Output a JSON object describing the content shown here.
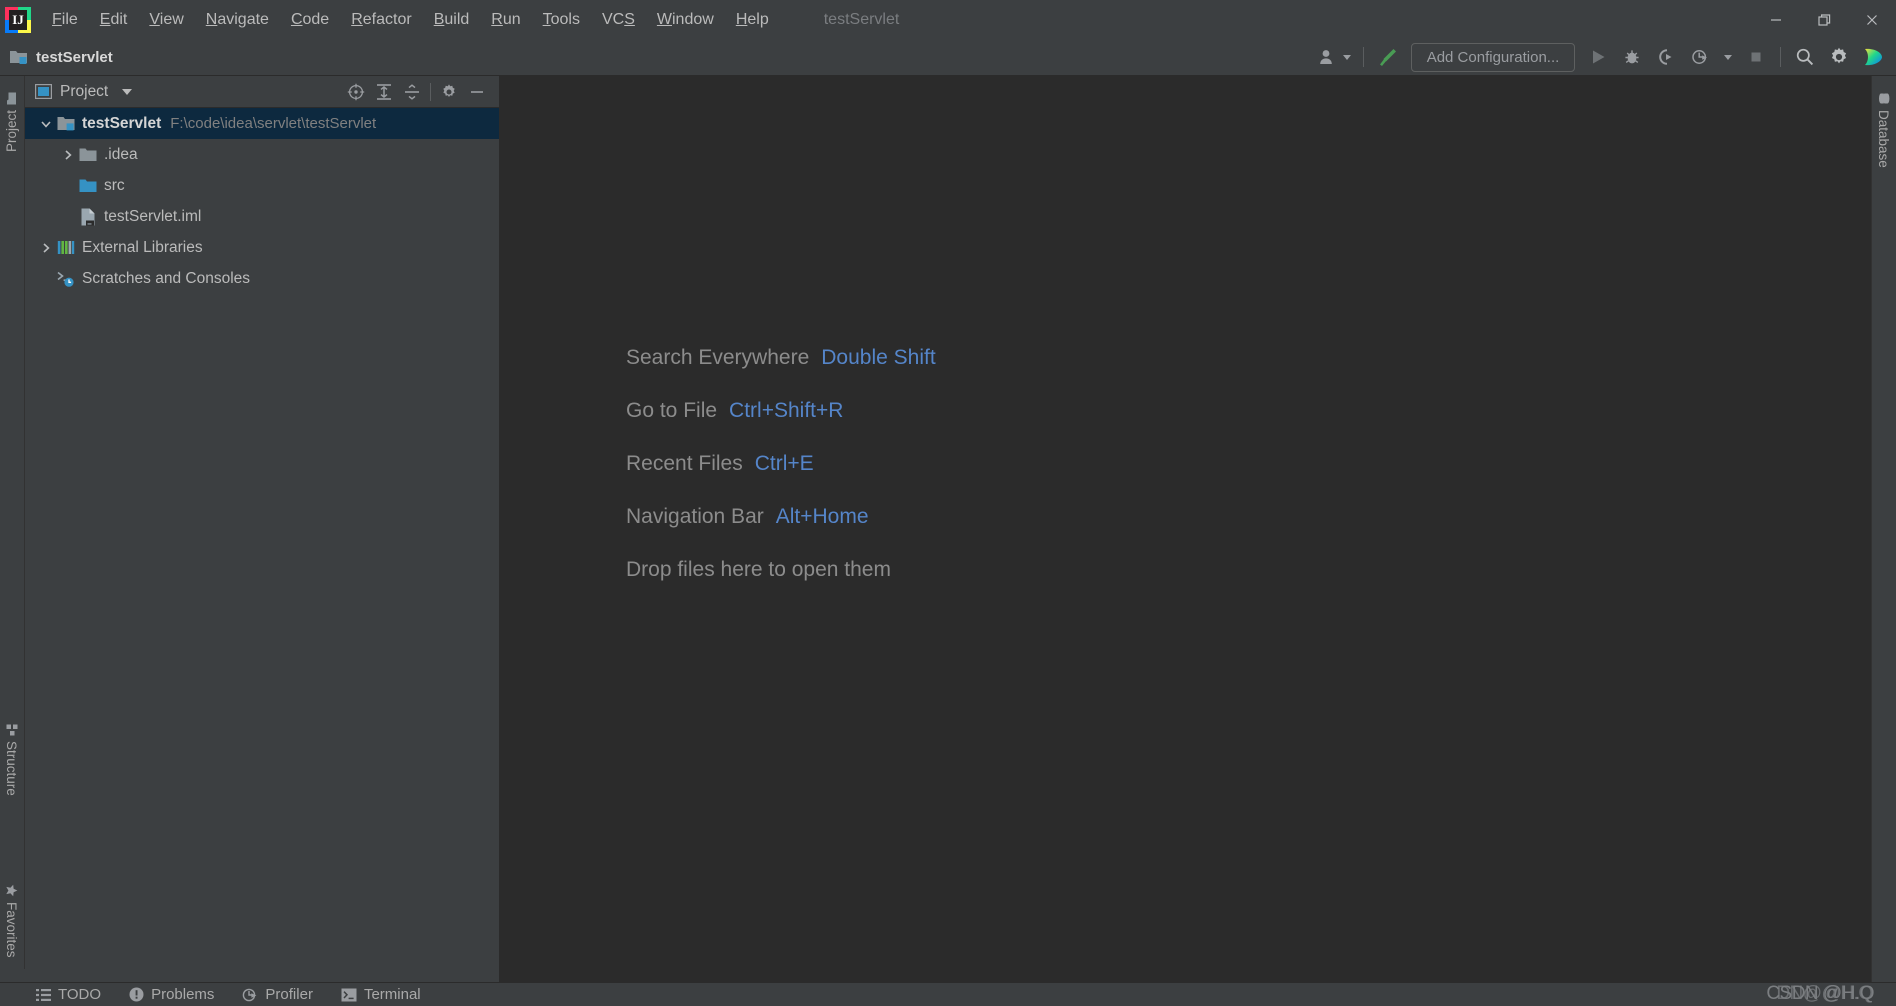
{
  "window": {
    "title": "testServlet",
    "controls": [
      {
        "name": "minimize-button",
        "glyph": "minimize"
      },
      {
        "name": "restore-button",
        "glyph": "restore"
      },
      {
        "name": "close-button",
        "glyph": "close"
      }
    ]
  },
  "menubar": {
    "logo_text": "IJ",
    "items": [
      {
        "label": "File",
        "mnemonic": "F",
        "rest": "ile"
      },
      {
        "label": "Edit",
        "mnemonic": "E",
        "rest": "dit"
      },
      {
        "label": "View",
        "mnemonic": "V",
        "rest": "iew"
      },
      {
        "label": "Navigate",
        "mnemonic": "N",
        "rest": "avigate"
      },
      {
        "label": "Code",
        "mnemonic": "C",
        "rest": "ode"
      },
      {
        "label": "Refactor",
        "mnemonic": "R",
        "rest": "efactor"
      },
      {
        "label": "Build",
        "mnemonic": "B",
        "rest": "uild"
      },
      {
        "label": "Run",
        "mnemonic": "R",
        "rest": "un",
        "split": true
      },
      {
        "label": "Tools",
        "mnemonic": "T",
        "rest": "ools"
      },
      {
        "label": "VCS",
        "mnemonic": "VC",
        "rest": "S",
        "tail": true
      },
      {
        "label": "Window",
        "mnemonic": "W",
        "rest": "indow"
      },
      {
        "label": "Help",
        "mnemonic": "H",
        "rest": "elp"
      }
    ]
  },
  "toolbar": {
    "project_chip_label": "testServlet",
    "add_configuration_label": "Add Configuration...",
    "buttons": [
      {
        "name": "user-account-button",
        "icon": "user-icon"
      },
      {
        "name": "build-hammer-button",
        "icon": "hammer-icon"
      },
      {
        "name": "run-button",
        "icon": "run-icon"
      },
      {
        "name": "debug-button",
        "icon": "debug-icon"
      },
      {
        "name": "run-coverage-button",
        "icon": "coverage-icon"
      },
      {
        "name": "profile-button",
        "icon": "profiler-icon"
      },
      {
        "name": "more-runners-button",
        "icon": "chevron-down-icon"
      },
      {
        "name": "stop-button",
        "icon": "stop-icon"
      },
      {
        "name": "search-everywhere-button",
        "icon": "search-icon"
      },
      {
        "name": "settings-button",
        "icon": "gear-icon"
      },
      {
        "name": "ide-feature-button",
        "icon": "toolbox-icon"
      }
    ]
  },
  "project_panel": {
    "title": "Project",
    "tools": [
      {
        "name": "select-opened-file-button",
        "icon": "locate-icon"
      },
      {
        "name": "expand-all-button",
        "icon": "expand-all-icon"
      },
      {
        "name": "collapse-all-button",
        "icon": "collapse-all-icon"
      },
      {
        "name": "panel-settings-button",
        "icon": "gear-icon"
      },
      {
        "name": "hide-panel-button",
        "icon": "minimize-icon"
      }
    ],
    "tree": [
      {
        "label": "testServlet",
        "path": "F:\\code\\idea\\servlet\\testServlet",
        "icon": "module-folder-icon",
        "twisty": "expanded",
        "selected": true,
        "depth": 0,
        "bold": true
      },
      {
        "label": ".idea",
        "path": "",
        "icon": "folder-icon",
        "twisty": "collapsed",
        "selected": false,
        "depth": 1,
        "bold": false
      },
      {
        "label": "src",
        "path": "",
        "icon": "source-folder-icon",
        "twisty": "none",
        "selected": false,
        "depth": 1,
        "bold": false
      },
      {
        "label": "testServlet.iml",
        "path": "",
        "icon": "iml-file-icon",
        "twisty": "none",
        "selected": false,
        "depth": 1,
        "bold": false
      },
      {
        "label": "External Libraries",
        "path": "",
        "icon": "libraries-icon",
        "twisty": "collapsed",
        "selected": false,
        "depth": 0,
        "bold": false
      },
      {
        "label": "Scratches and Consoles",
        "path": "",
        "icon": "scratches-icon",
        "twisty": "none",
        "selected": false,
        "depth": 0,
        "bold": false
      }
    ]
  },
  "editor": {
    "hints": [
      {
        "action": "Search Everywhere",
        "key": "Double Shift"
      },
      {
        "action": "Go to File",
        "key": "Ctrl+Shift+R"
      },
      {
        "action": "Recent Files",
        "key": "Ctrl+E"
      },
      {
        "action": "Navigation Bar",
        "key": "Alt+Home"
      }
    ],
    "drop_hint": "Drop files here to open them"
  },
  "stripes": {
    "left_top": [
      {
        "label": "Project",
        "icon": "project-icon"
      }
    ],
    "left_bottom": [
      {
        "label": "Structure",
        "icon": "structure-icon"
      },
      {
        "label": "Favorites",
        "icon": "star-icon"
      }
    ],
    "right_top": [
      {
        "label": "Database",
        "icon": "database-icon"
      }
    ]
  },
  "statusbar": {
    "items": [
      {
        "label": "TODO",
        "icon": "todo-icon"
      },
      {
        "label": "Problems",
        "icon": "problems-icon"
      },
      {
        "label": "Profiler",
        "icon": "profiler-icon"
      },
      {
        "label": "Terminal",
        "icon": "terminal-icon"
      }
    ],
    "watermark": "CSDN @H.Q",
    "watermark_alt": "DN@@H.Q"
  },
  "colors": {
    "accent_blue": "#5585c9",
    "selection": "#0d293f",
    "panel_bg": "#3c3f41",
    "editor_bg": "#2b2b2b",
    "text": "#bbbbbb",
    "muted": "#808080",
    "folder": "#9aa7b0",
    "source_folder": "#3592c4",
    "green": "#499c54"
  }
}
